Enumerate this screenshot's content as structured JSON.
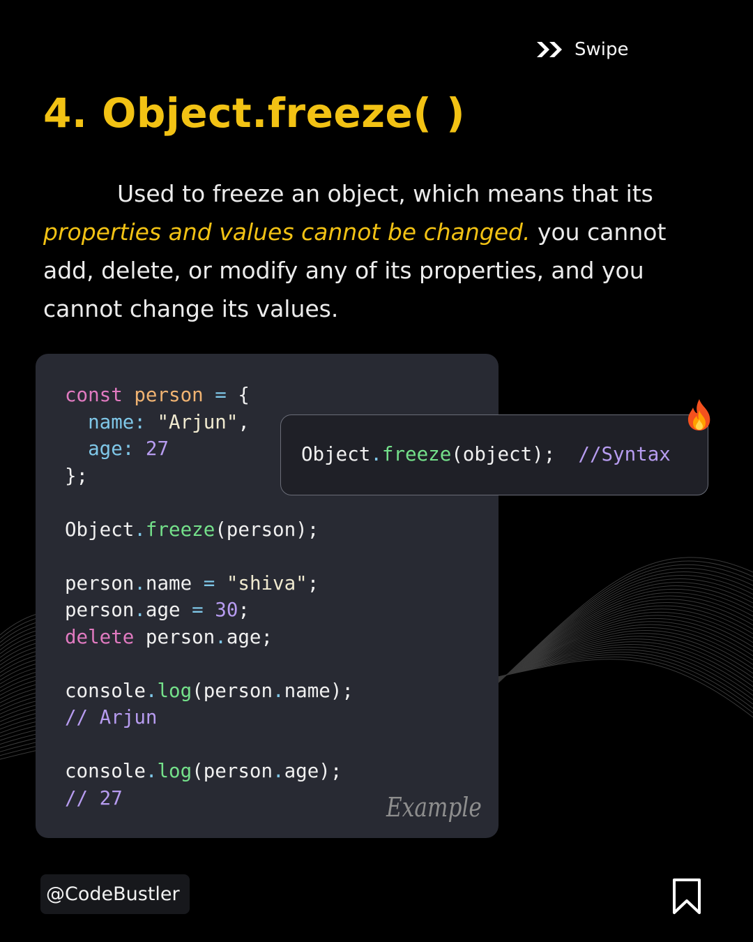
{
  "swipe": {
    "label": "Swipe",
    "icon": "double-chevron-right-icon"
  },
  "title": "4. Object.freeze( )",
  "description": {
    "part1": "Used to freeze an object, which means that its",
    "highlight": "properties and values cannot be changed.",
    "part2": " you cannot add, delete, or modify any of its properties, and you cannot change its values."
  },
  "code_lines": [
    "const person = {",
    "  name: \"Arjun\",",
    "  age: 27",
    "};",
    "",
    "Object.freeze(person);",
    "",
    "person.name = \"shiva\";",
    "person.age = 30;",
    "delete person.age;",
    "",
    "console.log(person.name);",
    "// Arjun",
    "",
    "console.log(person.age);",
    "// 27"
  ],
  "example_label": "Example",
  "syntax": {
    "code": "Object.freeze(object);",
    "comment": "//Syntax"
  },
  "handle": "@CodeBustler",
  "icons": {
    "fire": "fire-icon",
    "bookmark": "bookmark-icon"
  },
  "colors": {
    "accent": "#f2c214",
    "code_bg": "#282a33",
    "background": "#000000"
  }
}
